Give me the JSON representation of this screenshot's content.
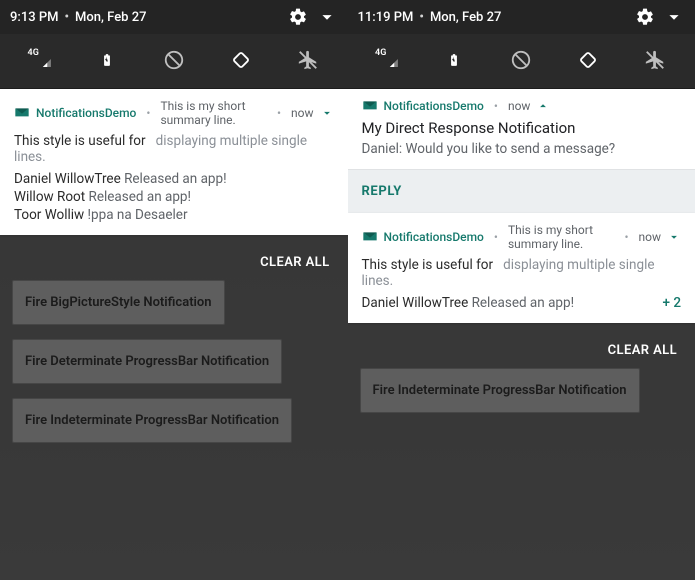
{
  "left": {
    "status": {
      "time": "9:13 PM",
      "date": "Mon, Feb 27"
    },
    "signal_label": "4G",
    "notification": {
      "app": "NotificationsDemo",
      "summary": "This is my short summary line.",
      "time": "now",
      "style_prefix": "This style is useful for",
      "style_suffix": "displaying multiple single lines.",
      "lines": [
        {
          "who": "Daniel WillowTree",
          "rest": " Released an app!"
        },
        {
          "who": "Willow Root",
          "rest": " Released an app!"
        },
        {
          "who": "Toor Wolliw",
          "rest": " !ppa na Desaeler"
        }
      ]
    },
    "clear_all": "CLEAR ALL",
    "buttons": [
      "Fire BigPictureStyle Notification",
      "Fire Determinate ProgressBar Notification",
      "Fire Indeterminate ProgressBar Notification"
    ]
  },
  "right": {
    "status": {
      "time": "11:19 PM",
      "date": "Mon, Feb 27"
    },
    "signal_label": "4G",
    "direct": {
      "app": "NotificationsDemo",
      "time": "now",
      "title": "My Direct Response Notification",
      "body": "Daniel: Would you like to send a message?",
      "reply": "REPLY"
    },
    "inbox": {
      "app": "NotificationsDemo",
      "summary": "This is my short summary line.",
      "time": "now",
      "style_prefix": "This style is useful for",
      "style_suffix": "displaying multiple single lines.",
      "line": {
        "who": "Daniel WillowTree",
        "rest": " Released an app!"
      },
      "plus": "+ 2"
    },
    "clear_all": "CLEAR ALL",
    "buttons": [
      "Fire Indeterminate ProgressBar Notification"
    ]
  }
}
